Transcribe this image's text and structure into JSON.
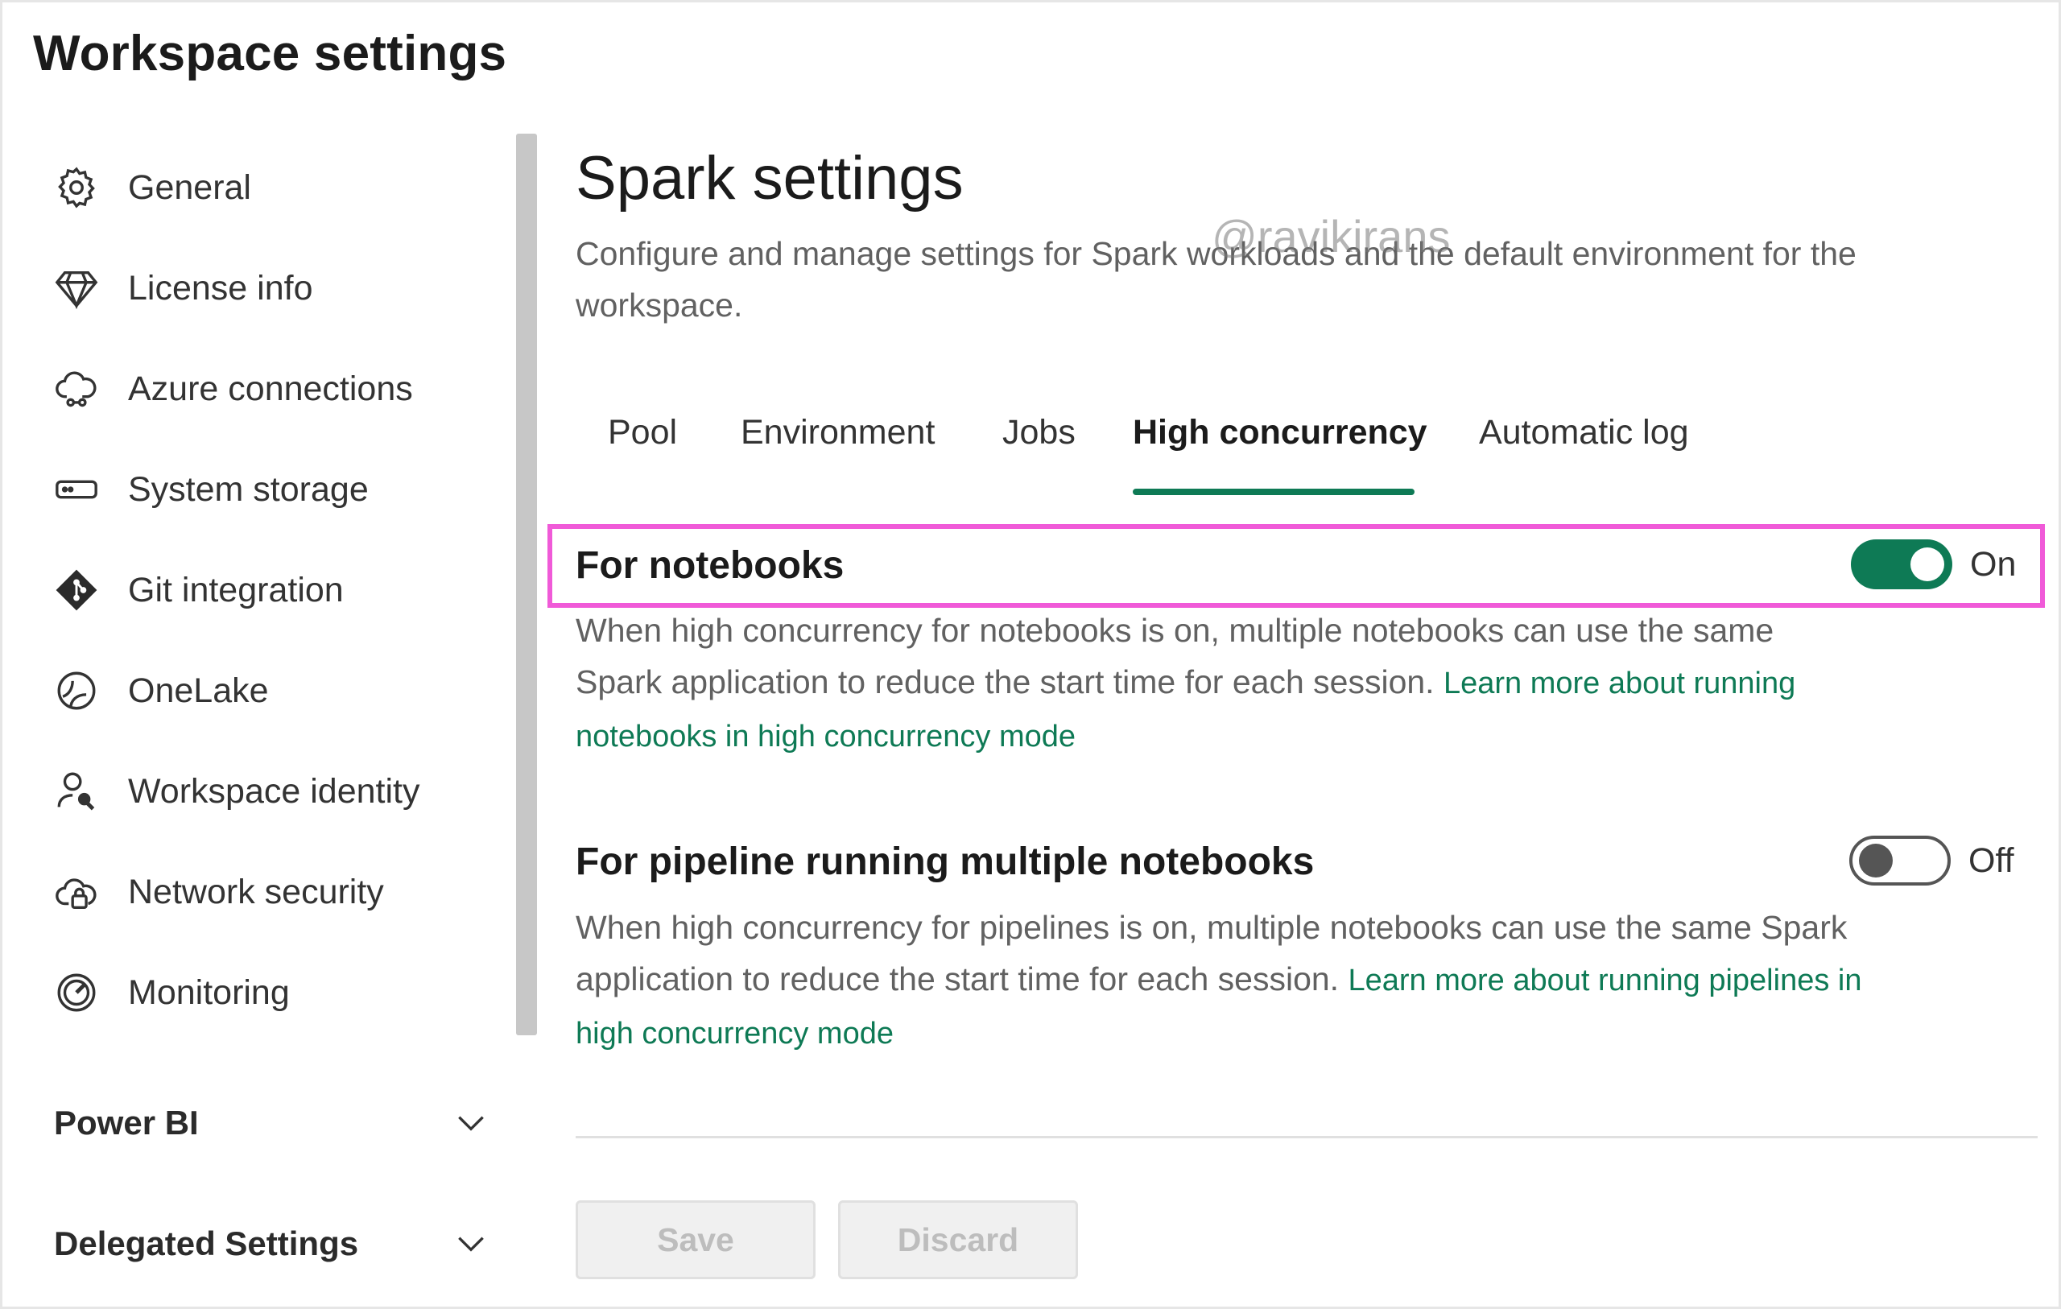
{
  "workspace": {
    "title": "Workspace settings"
  },
  "sidebar": {
    "items": [
      {
        "label": "General",
        "icon": "gear-icon"
      },
      {
        "label": "License info",
        "icon": "diamond-icon"
      },
      {
        "label": "Azure connections",
        "icon": "cloud-connection-icon"
      },
      {
        "label": "System storage",
        "icon": "storage-icon"
      },
      {
        "label": "Git integration",
        "icon": "git-icon"
      },
      {
        "label": "OneLake",
        "icon": "onelake-icon"
      },
      {
        "label": "Workspace identity",
        "icon": "identity-key-icon"
      },
      {
        "label": "Network security",
        "icon": "cloud-lock-icon"
      },
      {
        "label": "Monitoring",
        "icon": "gauge-icon"
      }
    ],
    "sections": [
      {
        "label": "Power BI",
        "icon": "chevron-down-icon"
      },
      {
        "label": "Delegated Settings",
        "icon": "chevron-down-icon"
      }
    ]
  },
  "main": {
    "title": "Spark settings",
    "description": "Configure and manage settings for Spark workloads and the default environment for the workspace.",
    "watermark": "@ravikirans",
    "tabs": [
      {
        "label": "Pool"
      },
      {
        "label": "Environment"
      },
      {
        "label": "Jobs"
      },
      {
        "label": "High concurrency",
        "active": true
      },
      {
        "label": "Automatic log"
      }
    ],
    "settings": [
      {
        "title": "For notebooks",
        "state": "On",
        "enabled": true,
        "description": "When high concurrency for notebooks is on, multiple notebooks can use the same Spark application to reduce the start time for each session.",
        "link": "Learn more about running notebooks in high concurrency mode"
      },
      {
        "title": "For pipeline running multiple notebooks",
        "state": "Off",
        "enabled": false,
        "description": "When high concurrency for pipelines is on, multiple notebooks can use the same Spark application to reduce the start time for each session.",
        "link": "Learn more about running pipelines in high concurrency mode"
      }
    ],
    "buttons": {
      "save": "Save",
      "discard": "Discard"
    }
  },
  "colors": {
    "accent": "#0e7a55",
    "highlight": "#f05ad8",
    "muted_text": "#616161"
  }
}
